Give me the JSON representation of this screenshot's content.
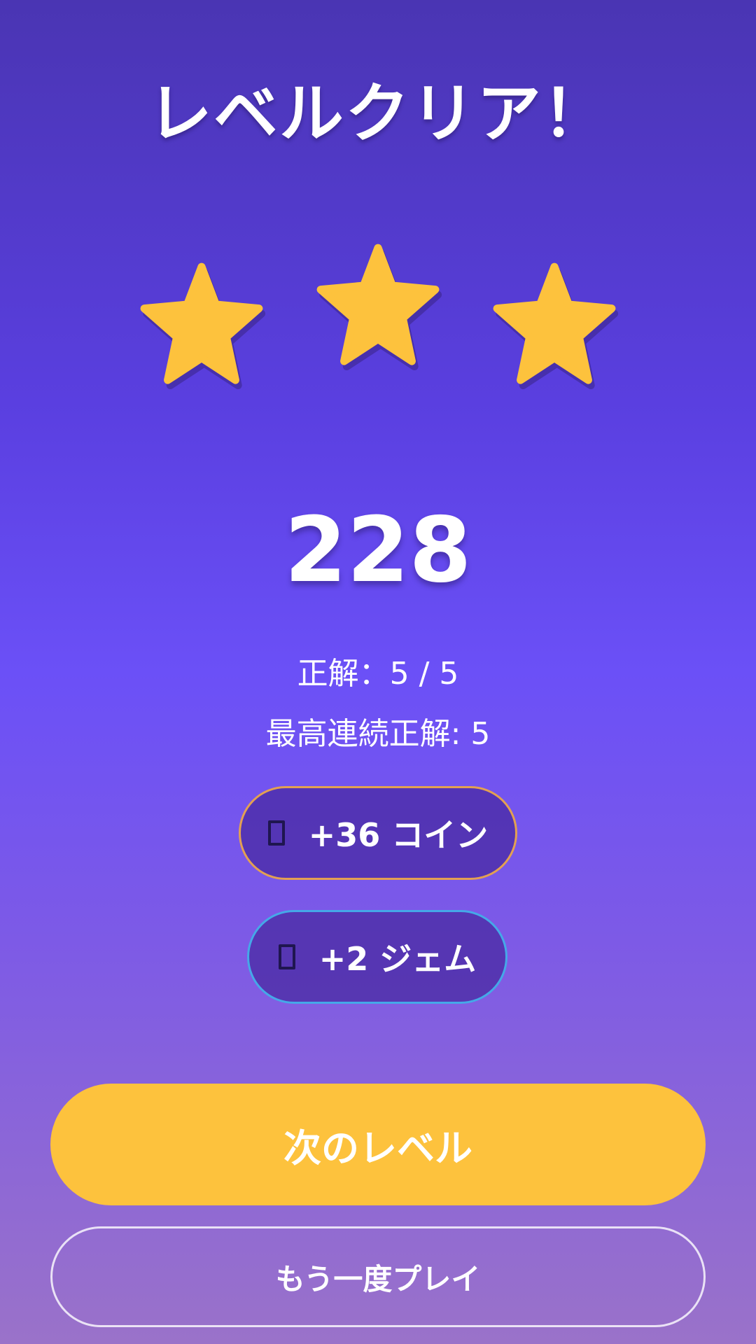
{
  "title": "レベルクリア！",
  "stars": {
    "earned": 3,
    "total": 3,
    "icon": "star-icon",
    "color": "#FDC23D"
  },
  "score": "228",
  "stats": {
    "correct": "正解：5 / 5",
    "streak": "最高連続正解: 5"
  },
  "rewards": {
    "coins": {
      "label": "+36 コイン",
      "icon": "coin-icon",
      "border_color": "#E3A052"
    },
    "gems": {
      "label": "+2 ジェム",
      "icon": "gem-icon",
      "border_color": "#45A8E8"
    }
  },
  "buttons": {
    "next_level": "次のレベル",
    "replay": "もう一度プレイ"
  },
  "colors": {
    "accent": "#FDC23D",
    "background_top": "#4A35B3",
    "background_bottom": "#9A72C9"
  }
}
